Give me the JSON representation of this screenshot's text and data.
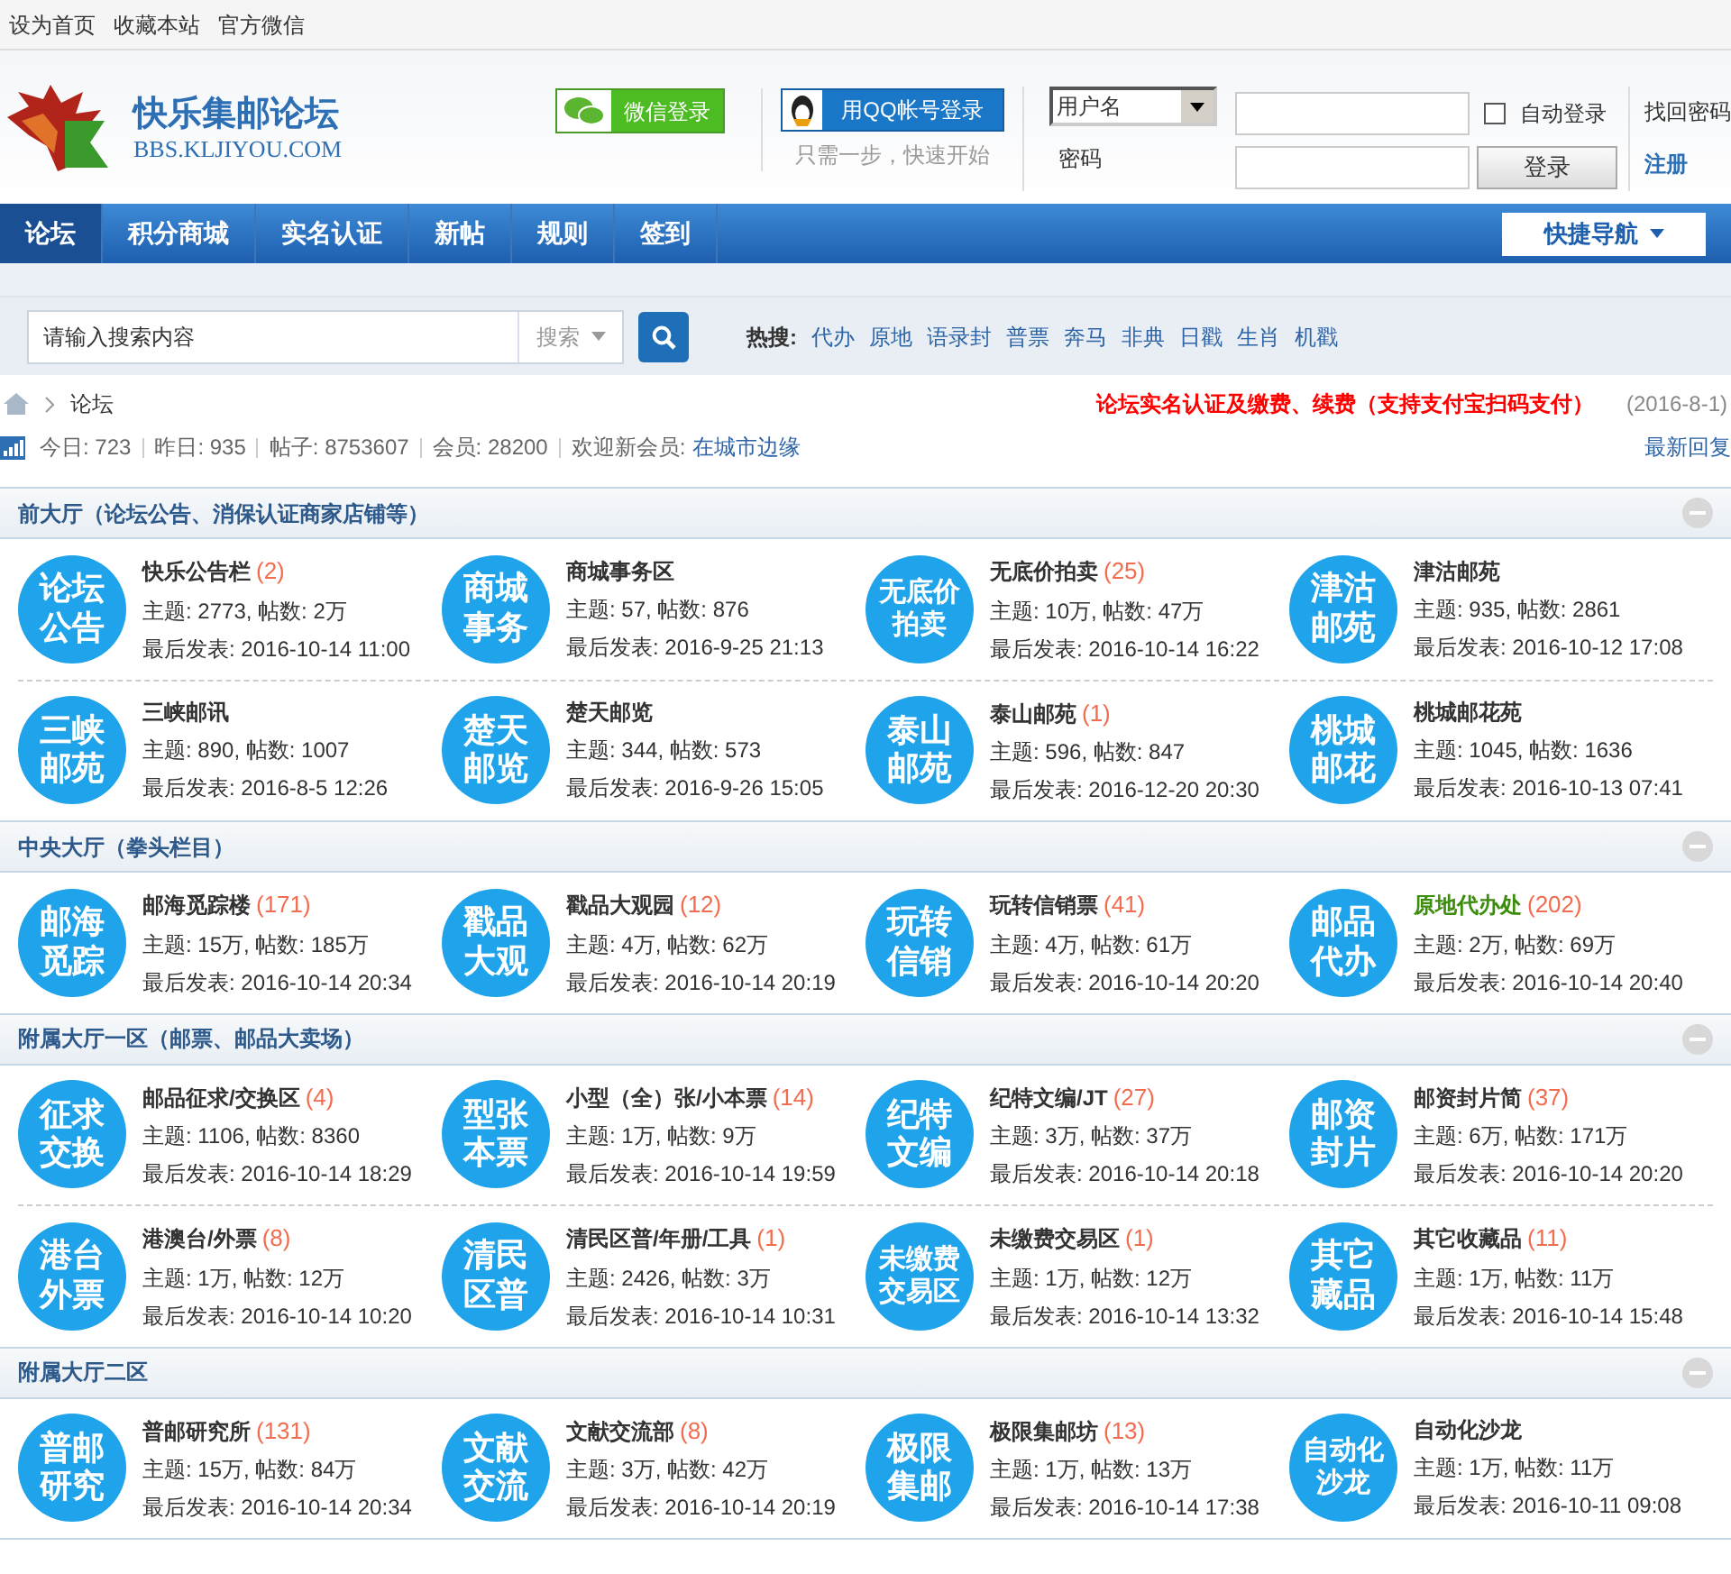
{
  "top_links": [
    "设为首页",
    "收藏本站",
    "官方微信"
  ],
  "logo": {
    "title": "快乐集邮论坛",
    "url": "BBS.KLJIYOU.COM"
  },
  "social_login": {
    "wechat": "微信登录",
    "qq": "用QQ帐号登录",
    "hint": "只需一步，快速开始"
  },
  "login": {
    "account_type": "用户名",
    "password_label": "密码",
    "auto_login": "自动登录",
    "auto_checked": false,
    "submit": "登录",
    "forgot": "找回密码",
    "register": "注册"
  },
  "nav": [
    {
      "label": "论坛",
      "selected": true
    },
    {
      "label": "积分商城",
      "selected": false
    },
    {
      "label": "实名认证",
      "selected": false
    },
    {
      "label": "新帖",
      "selected": false
    },
    {
      "label": "规则",
      "selected": false
    },
    {
      "label": "签到",
      "selected": false
    }
  ],
  "quick_nav": "快捷导航",
  "search": {
    "placeholder": "请输入搜索内容",
    "type": "搜索",
    "hot_label": "热搜:",
    "hot": [
      "代办",
      "原地",
      "语录封",
      "普票",
      "奔马",
      "非典",
      "日戳",
      "生肖",
      "机戳"
    ]
  },
  "breadcrumb": "论坛",
  "notice": "论坛实名认证及缴费、续费（支持支付宝扫码支付）",
  "notice_date": "(2016-8-1)",
  "stats": [
    {
      "label": "今日:",
      "value": "723"
    },
    {
      "label": "昨日:",
      "value": "935"
    },
    {
      "label": "帖子:",
      "value": "8753607"
    },
    {
      "label": "会员:",
      "value": "28200"
    }
  ],
  "new_member_label": "欢迎新会员:",
  "new_member": "在城市边缘",
  "latest_replies": "最新回复",
  "sections": [
    {
      "title": "前大厅（论坛公告、消保认证商家店铺等）",
      "expanded": true,
      "rows": [
        [
          {
            "icon": [
              "论坛",
              "公告"
            ],
            "name": "快乐公告栏",
            "count": "(2)",
            "highlighted": false,
            "stats": "主题: 2773, 帖数: 2万",
            "last": "最后发表: 2016-10-14 11:00"
          },
          {
            "icon": [
              "商城",
              "事务"
            ],
            "name": "商城事务区",
            "highlighted": false,
            "stats": "主题: 57, 帖数: 876",
            "last": "最后发表: 2016-9-25 21:13"
          },
          {
            "icon": [
              "无底价",
              "拍卖"
            ],
            "name": "无底价拍卖",
            "count": "(25)",
            "highlighted": false,
            "stats": "主题: 10万, 帖数: 47万",
            "last": "最后发表: 2016-10-14 16:22"
          },
          {
            "icon": [
              "津沽",
              "邮苑"
            ],
            "name": "津沽邮苑",
            "highlighted": false,
            "stats": "主题: 935, 帖数: 2861",
            "last": "最后发表: 2016-10-12 17:08"
          }
        ],
        [
          {
            "icon": [
              "三峡",
              "邮苑"
            ],
            "name": "三峡邮讯",
            "highlighted": false,
            "stats": "主题: 890, 帖数: 1007",
            "last": "最后发表: 2016-8-5 12:26"
          },
          {
            "icon": [
              "楚天",
              "邮览"
            ],
            "name": "楚天邮览",
            "highlighted": false,
            "stats": "主题: 344, 帖数: 573",
            "last": "最后发表: 2016-9-26 15:05"
          },
          {
            "icon": [
              "泰山",
              "邮苑"
            ],
            "name": "泰山邮苑",
            "count": "(1)",
            "highlighted": false,
            "stats": "主题: 596, 帖数: 847",
            "last": "最后发表: 2016-12-20 20:30"
          },
          {
            "icon": [
              "桃城",
              "邮花"
            ],
            "name": "桃城邮花苑",
            "highlighted": false,
            "stats": "主题: 1045, 帖数: 1636",
            "last": "最后发表: 2016-10-13 07:41"
          }
        ]
      ]
    },
    {
      "title": "中央大厅（拳头栏目）",
      "expanded": true,
      "rows": [
        [
          {
            "icon": [
              "邮海",
              "觅踪"
            ],
            "name": "邮海觅踪楼",
            "count": "(171)",
            "highlighted": false,
            "stats": "主题: 15万, 帖数: 185万",
            "last": "最后发表: 2016-10-14 20:34"
          },
          {
            "icon": [
              "戳品",
              "大观"
            ],
            "name": "戳品大观园",
            "count": "(12)",
            "highlighted": false,
            "stats": "主题: 4万, 帖数: 62万",
            "last": "最后发表: 2016-10-14 20:19"
          },
          {
            "icon": [
              "玩转",
              "信销"
            ],
            "name": "玩转信销票",
            "count": "(41)",
            "highlighted": false,
            "stats": "主题: 4万, 帖数: 61万",
            "last": "最后发表: 2016-10-14 20:20"
          },
          {
            "icon": [
              "邮品",
              "代办"
            ],
            "name": "原地代办处",
            "count": "(202)",
            "highlighted": true,
            "stats": "主题: 2万, 帖数: 69万",
            "last": "最后发表: 2016-10-14 20:40"
          }
        ]
      ]
    },
    {
      "title": "附属大厅一区（邮票、邮品大卖场）",
      "expanded": true,
      "rows": [
        [
          {
            "icon": [
              "征求",
              "交换"
            ],
            "name": "邮品征求/交换区",
            "count": "(4)",
            "highlighted": false,
            "stats": "主题: 1106, 帖数: 8360",
            "last": "最后发表: 2016-10-14 18:29"
          },
          {
            "icon": [
              "型张",
              "本票"
            ],
            "name": "小型（全）张/小本票",
            "count": "(14)",
            "highlighted": false,
            "stats": "主题: 1万, 帖数: 9万",
            "last": "最后发表: 2016-10-14 19:59"
          },
          {
            "icon": [
              "纪特",
              "文编"
            ],
            "name": "纪特文编/JT",
            "count": "(27)",
            "highlighted": false,
            "stats": "主题: 3万, 帖数: 37万",
            "last": "最后发表: 2016-10-14 20:18"
          },
          {
            "icon": [
              "邮资",
              "封片"
            ],
            "name": "邮资封片简",
            "count": "(37)",
            "highlighted": false,
            "stats": "主题: 6万, 帖数: 171万",
            "last": "最后发表: 2016-10-14 20:20"
          }
        ],
        [
          {
            "icon": [
              "港台",
              "外票"
            ],
            "name": "港澳台/外票",
            "count": "(8)",
            "highlighted": false,
            "stats": "主题: 1万, 帖数: 12万",
            "last": "最后发表: 2016-10-14 10:20"
          },
          {
            "icon": [
              "清民",
              "区普"
            ],
            "name": "清民区普/年册/工具",
            "count": "(1)",
            "highlighted": false,
            "stats": "主题: 2426, 帖数: 3万",
            "last": "最后发表: 2016-10-14 10:31"
          },
          {
            "icon": [
              "未缴费",
              "交易区"
            ],
            "name": "未缴费交易区",
            "count": "(1)",
            "highlighted": false,
            "stats": "主题: 1万, 帖数: 12万",
            "last": "最后发表: 2016-10-14 13:32"
          },
          {
            "icon": [
              "其它",
              "藏品"
            ],
            "name": "其它收藏品",
            "count": "(11)",
            "highlighted": false,
            "stats": "主题: 1万, 帖数: 11万",
            "last": "最后发表: 2016-10-14 15:48"
          }
        ]
      ]
    },
    {
      "title": "附属大厅二区",
      "expanded": true,
      "rows": [
        [
          {
            "icon": [
              "普邮",
              "研究"
            ],
            "name": "普邮研究所",
            "count": "(131)",
            "highlighted": false,
            "stats": "主题: 15万, 帖数: 84万",
            "last": "最后发表: 2016-10-14 20:34"
          },
          {
            "icon": [
              "文献",
              "交流"
            ],
            "name": "文献交流部",
            "count": "(8)",
            "highlighted": false,
            "stats": "主题: 3万, 帖数: 42万",
            "last": "最后发表: 2016-10-14 20:19"
          },
          {
            "icon": [
              "极限",
              "集邮"
            ],
            "name": "极限集邮坊",
            "count": "(13)",
            "highlighted": false,
            "stats": "主题: 1万, 帖数: 13万",
            "last": "最后发表: 2016-10-14 17:38"
          },
          {
            "icon": [
              "自动化",
              "沙龙"
            ],
            "name": "自动化沙龙",
            "highlighted": false,
            "stats": "主题: 1万, 帖数: 11万",
            "last": "最后发表: 2016-10-11 09:08"
          }
        ]
      ]
    }
  ]
}
